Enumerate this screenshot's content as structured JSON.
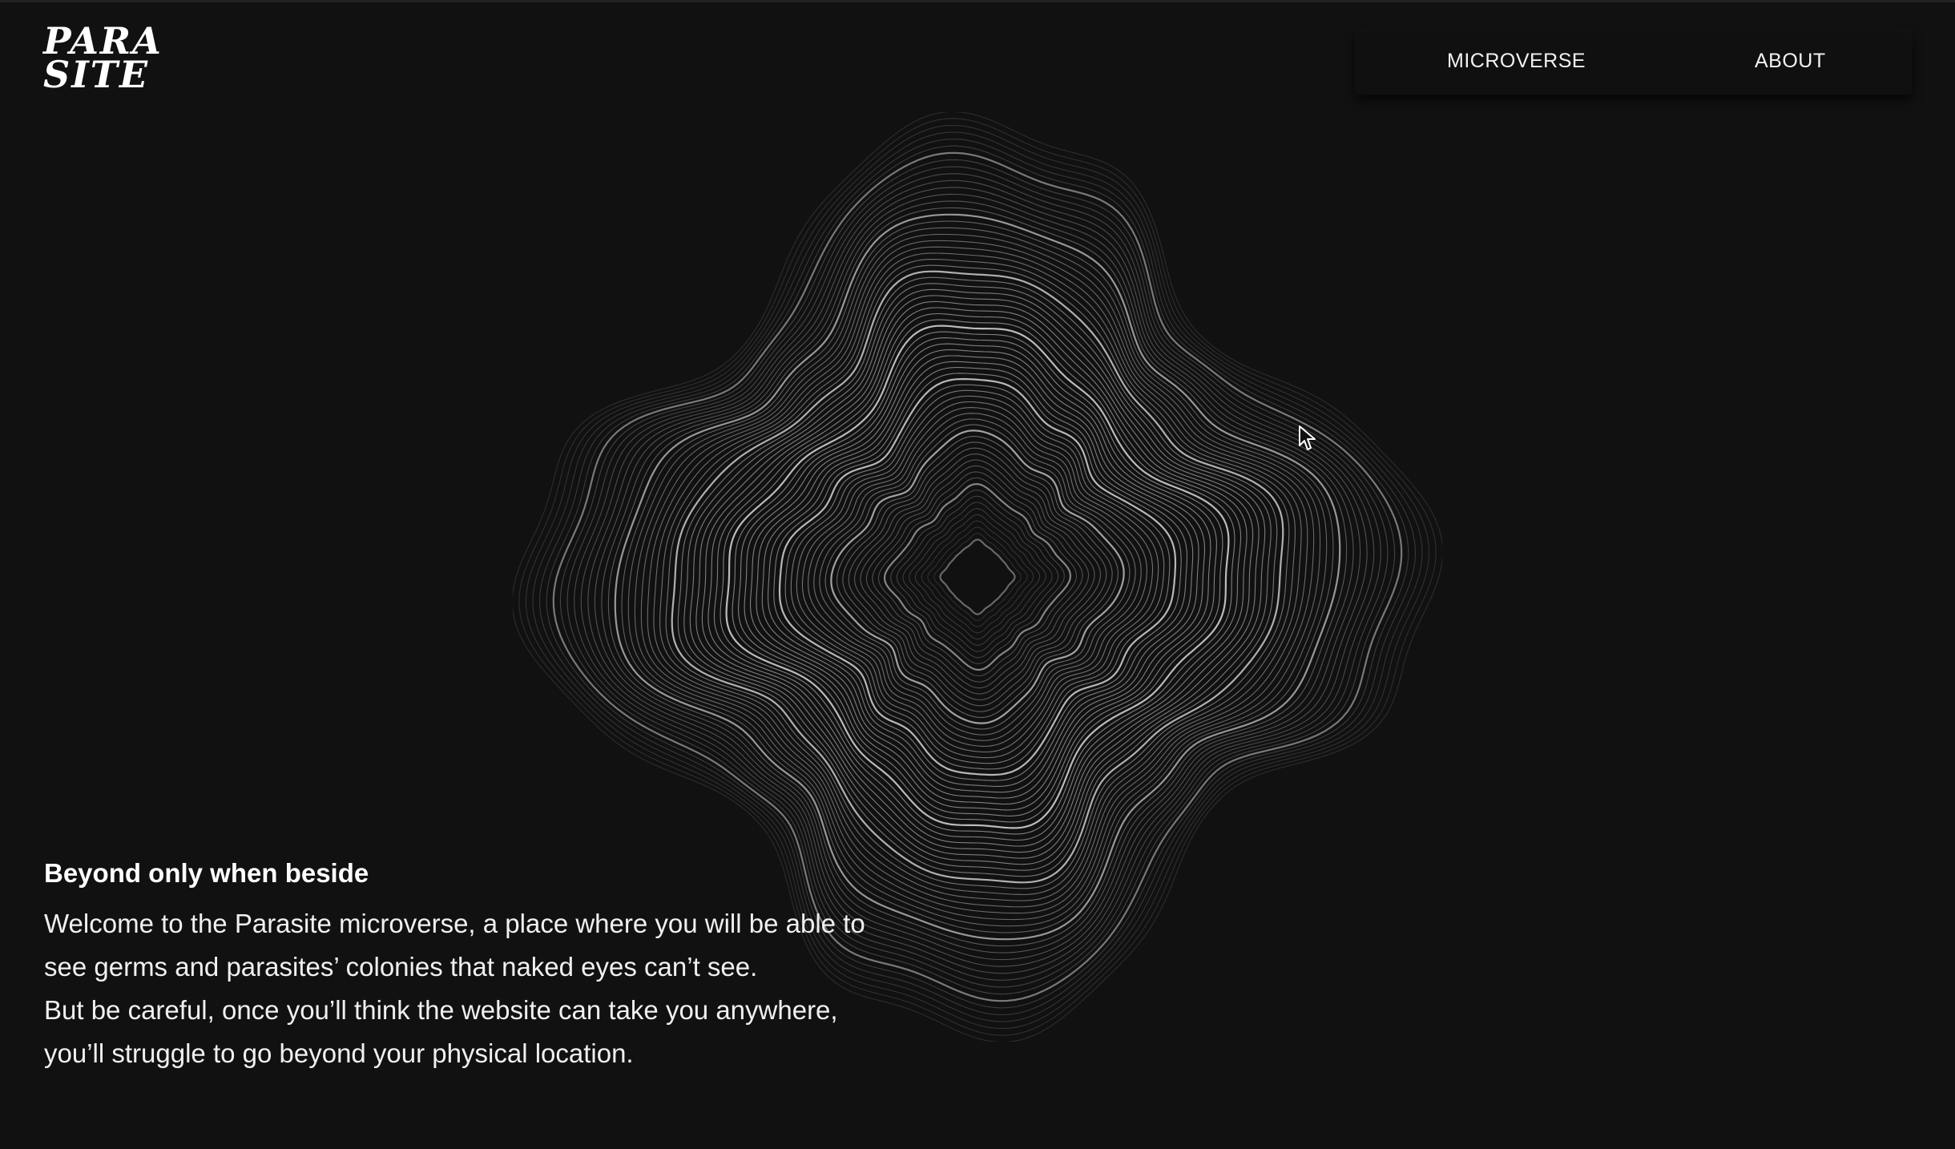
{
  "brand": {
    "logo_line_1": "PARA",
    "logo_line_2": "SITE"
  },
  "nav": {
    "items": [
      {
        "label": "MICROVERSE"
      },
      {
        "label": "ABOUT"
      }
    ]
  },
  "hero": {
    "headline": "Beyond only when beside",
    "lines": [
      "Welcome to the Parasite microverse, a place where you will be able to",
      "see germs and parasites’ colonies that naked eyes can’t see.",
      "But be careful, once you’ll think the website can take you anywhere,",
      "you’ll struggle to go beyond your physical location."
    ]
  },
  "colors": {
    "background": "#111111",
    "text": "#ffffff",
    "line_art": "#ffffff"
  },
  "icons": {
    "cursor": "arrow-pointer-icon"
  }
}
